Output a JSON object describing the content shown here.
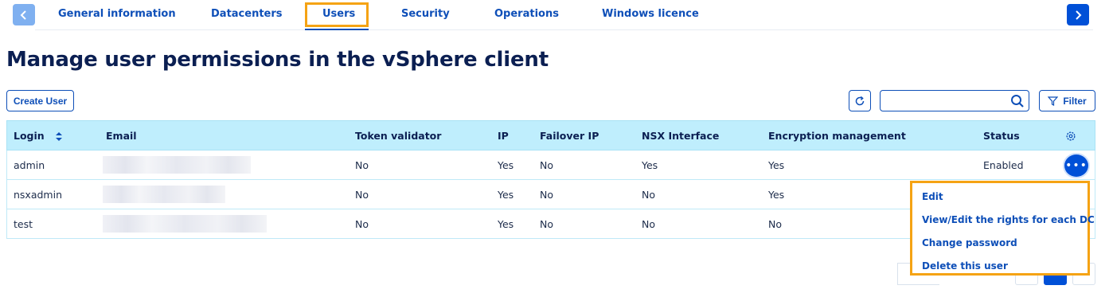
{
  "tabs": {
    "prev_icon": "chevron-left-icon",
    "next_icon": "chevron-right-icon",
    "items": [
      {
        "label": "General information"
      },
      {
        "label": "Datacenters"
      },
      {
        "label": "Users"
      },
      {
        "label": "Security"
      },
      {
        "label": "Operations"
      },
      {
        "label": "Windows licence"
      }
    ],
    "active": "Users"
  },
  "page": {
    "title": "Manage user permissions in the vSphere client"
  },
  "toolbar": {
    "create_user_label": "Create User",
    "refresh_icon": "refresh-icon",
    "search_value": "",
    "search_icon": "search-icon",
    "filter_label": "Filter",
    "filter_icon": "funnel-icon"
  },
  "table": {
    "columns": [
      "Login",
      "Email",
      "Token validator",
      "IP",
      "Failover IP",
      "NSX Interface",
      "Encryption management",
      "Status"
    ],
    "rows": [
      {
        "login": "admin",
        "email": "",
        "token_validator": "No",
        "ip": "Yes",
        "failover_ip": "No",
        "nsx_interface": "Yes",
        "encryption": "Yes",
        "status": "Enabled"
      },
      {
        "login": "nsxadmin",
        "email": "",
        "token_validator": "No",
        "ip": "Yes",
        "failover_ip": "No",
        "nsx_interface": "No",
        "encryption": "Yes",
        "status": ""
      },
      {
        "login": "test",
        "email": "",
        "token_validator": "No",
        "ip": "Yes",
        "failover_ip": "No",
        "nsx_interface": "No",
        "encryption": "No",
        "status": ""
      }
    ]
  },
  "row_menu": {
    "items": [
      {
        "label": "Edit"
      },
      {
        "label": "View/Edit the rights for each DC"
      },
      {
        "label": "Change password"
      },
      {
        "label": "Delete this user"
      }
    ]
  },
  "colors": {
    "accent": "#0050d7",
    "link": "#0e4fb8",
    "highlight": "#f5a314",
    "header_bg": "#bfeefd"
  }
}
